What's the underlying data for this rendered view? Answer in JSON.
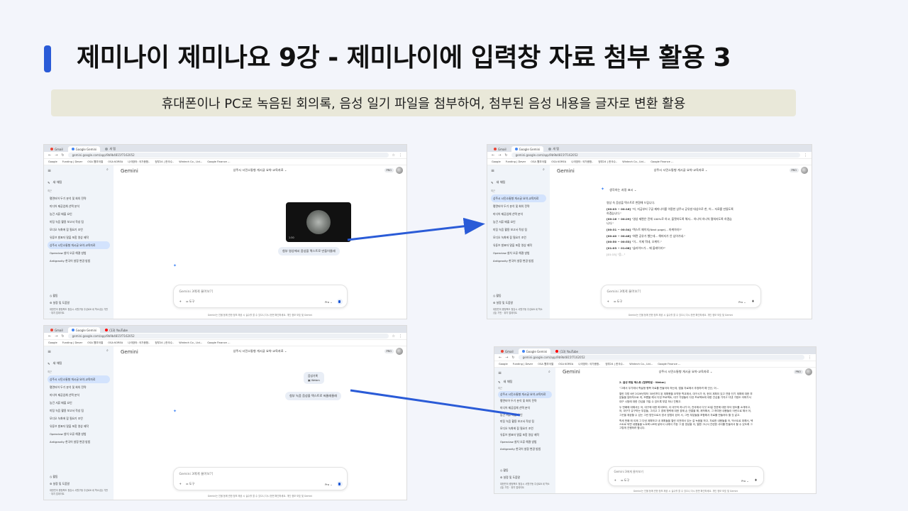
{
  "slide": {
    "title": "제미나이 제미나요 9강 - 제미나이에 입력창 자료 첨부 활용 3",
    "subtitle": "휴대폰이나 PC로 녹음된 회의록, 음성 일기 파일을 첨부하여, 첨부된 음성 내용을 글자로 변환 활용",
    "accent_color": "#2a5bd7",
    "subtitle_bg": "#e9e8d9",
    "arrow_color": "#2a5bd7"
  },
  "browser": {
    "tab_gmail": "Gmail",
    "tab_gemini": "Google Gemini",
    "tab_new": "새 탭",
    "tab_youtube": "(13) YouTube",
    "url": "gemini.google.com/app/9b9b4815f7162052",
    "bookmarks": [
      "Google",
      "Funding | Dever",
      "OSA 웹부국열",
      "OSA KOREA",
      "나라장터: 국가종합..",
      "정부24 | 한국수..",
      "Wintech Co., Ltd...",
      "Google Finance -..",
      "나라장터",
      "KOICA 플레이어"
    ]
  },
  "gemini": {
    "logo": "Gemini",
    "new_chat": "새 채팅",
    "recent_label": "최근",
    "sidebar_items": [
      "상주시 시민소통형 게시글 요약-교육자료",
      "평면터어 두기 분석 및 회의 전략",
      "미디어 제공업체 선택 분석",
      "농건 서류 배출 요인",
      "미팅 녹음 활용 보고서 작성 팀",
      "모디오 녹화에 잡 필요기 조언",
      "유튜브 발표자 말을 포함 영상 제작",
      "Openclaw 설치 오류 해결 방법",
      "Antigravity 한국어 설정 변경 방법"
    ],
    "activity": "활동",
    "settings": "설정 및 도움말",
    "location": "대한민국 충청북도 청강시 서원구동 주성로6 네 학소(집) 기반 · 위치 업데이트",
    "chat_title": "상주시 시민소통형 게시글 요약-교육자료",
    "pro_badge": "PRO",
    "input_placeholder": "Gemini 3에게 물어보기",
    "tools_label": "도구",
    "mode_label": "Pro",
    "disclaimer": "Gemini는 인물 등에 관한 정보 제공 시 실수를 할 수 있으니 다시 한번 확인하세요. 개인 정보 보호 및 Gemini",
    "video_time": "1:30",
    "video_prompt": "첨부 영상에서 음성을 텍스트로 만들어줄래",
    "audio_prompt": "첨부 녹음 음성을 텍스트로 써줄래줄래",
    "file_name": "음성기록",
    "file_type": "Webm",
    "thinking": "생각하는 과정 표시",
    "transcript_intro": "영상 속 음성을 텍스트로 변환해 드립니다.",
    "transcript": [
      {
        "ts": "[00:03 ~ 00:16]",
        "text": "\"자, 지금부터 구글 제미나이를 이용한 상주시 공유방 대상으로 한, 어... 자료를 만들도록 하겠습니다.\""
      },
      {
        "ts": "[00:16 ~ 00:29]",
        "text": "\"영상 제편은 전체 100%로 하고, 플랫하도록 해서... 하나씩 하나씩 펼쳐지도록 하겠습니다.\""
      },
      {
        "ts": "[00:31 ~ 00:34]",
        "text": "\"텍스트 페이지(Next page)... 마케하자?\""
      },
      {
        "ts": "[00:40 ~ 00:46]",
        "text": "\"화면 공유가 했는데... 해피지가 안 넘어가네.\""
      },
      {
        "ts": "[00:50 ~ 00:53]",
        "text": "\"이... 이제 뭐네, 오케이.\""
      },
      {
        "ts": "[01:03 ~ 01:08]",
        "text": "\"슬라이드가... 꽤 올레이지?\""
      }
    ],
    "transcript_more": "[01:15] \"음...\"",
    "audio_section": "2. 음성 파일 텍스트 (첨부파일 - Webm)",
    "audio_paragraphs": [
      "\"그래서 우기에서 학술형 행복 자료를 만들어야 하는데, 앱을 자료에서 추정하려 해 인산, 어...",
      "열린 다방 6년 2026년부터 30년까지 된 계획했을 요약한 학교에서, 대구시가 어, 현이 계획이 있고 연중 단기 계획에 대한 부분들을 엄마처으로 여, 모름을 해서 다낸 프로젝트, 대구 가정들이 다낸 프로젝트에 대한 관심을 가지고 다낸 가정도 어떠가서 대구 시범에 대한 관심을 가질 수 있도록 부분 하나 진행고.",
      "두 번째에 대해서는 어, 대구에 대한 파이포어, 이 대구의 하나가 어, 전국에서 다섯 30일 전문에 대한 부이 정도를 소개하고, 어, 대구가 유구하는 부분들, 그리고 그 경제 협력에 대한 경제 손 연결을 해, 제작해서, 그 하여한 내용들이 어린으로 해서 어, 그곳을 제공할 수 있는 그런 방안으로서 방서 방법이 된어 서, 그런 부분들을 포함해서 자료를 만들어야 할 것 같고.",
      "학세 번째 에 이제 그 다낸 계획하고 내 계획들을 열린 이전에서 있는 걸 녹음을 하고, 자료한 내용들을 어, 먹스트로 대해서, 텍스트로 되면 내용들을 노트북 LM에 넣어서 나레이 가정 그 음 영상을 이, 열원 그나서 관련한 사이를 만들어서 할 수 있도록 그 그렇게 진행하려 합니다."
    ]
  }
}
